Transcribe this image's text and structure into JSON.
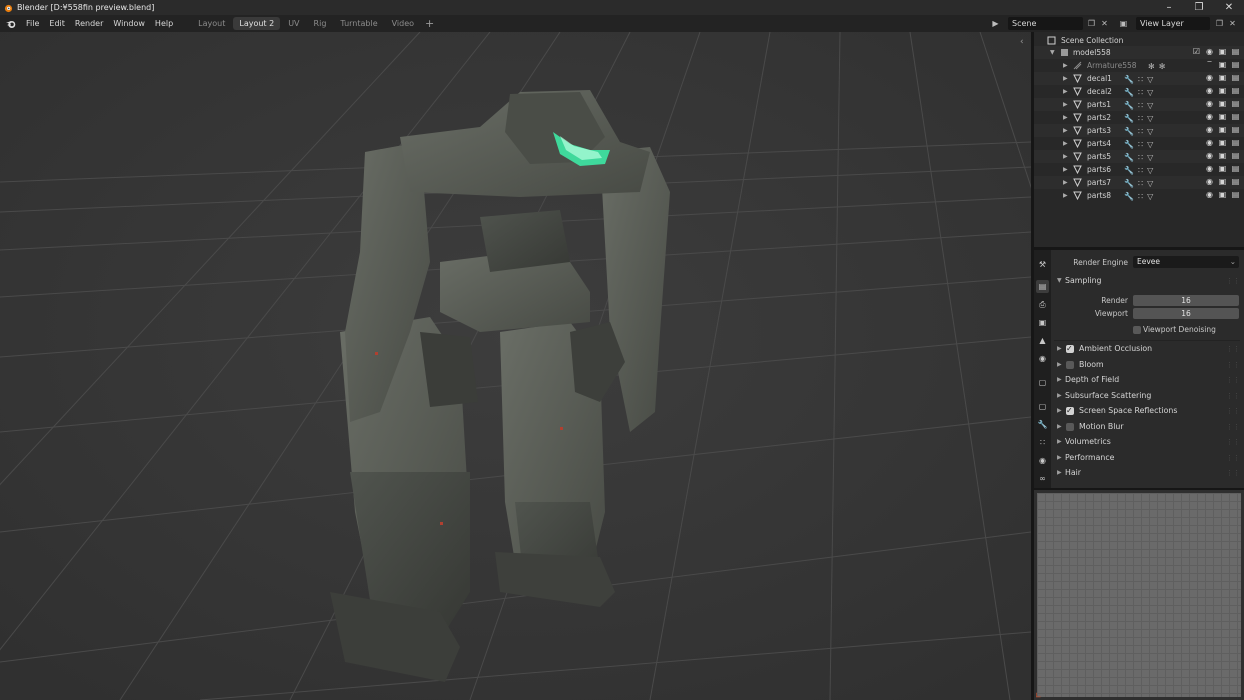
{
  "window": {
    "title": "Blender [D:¥558fin preview.blend]",
    "controls": [
      "minimize-icon",
      "maximize-icon",
      "close-icon"
    ]
  },
  "menu": {
    "items": [
      "File",
      "Edit",
      "Render",
      "Window",
      "Help"
    ]
  },
  "workspaces": {
    "tabs": [
      "Layout",
      "Layout 2",
      "UV",
      "Rig",
      "Turntable",
      "Video"
    ],
    "active": "Layout 2"
  },
  "header": {
    "scene": "Scene",
    "view_layer": "View Layer"
  },
  "outliner": {
    "root": "Scene Collection",
    "collection": "model558",
    "armature": "Armature558",
    "objects": [
      "decal1",
      "decal2",
      "parts1",
      "parts2",
      "parts3",
      "parts4",
      "parts5",
      "parts6",
      "parts7",
      "parts8"
    ]
  },
  "properties": {
    "render_engine_label": "Render Engine",
    "render_engine": "Eevee",
    "sampling": {
      "title": "Sampling",
      "render_label": "Render",
      "render_value": "16",
      "viewport_label": "Viewport",
      "viewport_value": "16",
      "denoise_label": "Viewport Denoising"
    },
    "panels": [
      {
        "label": "Ambient Occlusion",
        "checkbox": true,
        "checked": true
      },
      {
        "label": "Bloom",
        "checkbox": true,
        "checked": false
      },
      {
        "label": "Depth of Field",
        "checkbox": false
      },
      {
        "label": "Subsurface Scattering",
        "checkbox": false
      },
      {
        "label": "Screen Space Reflections",
        "checkbox": true,
        "checked": true
      },
      {
        "label": "Motion Blur",
        "checkbox": true,
        "checked": false
      },
      {
        "label": "Volumetrics",
        "checkbox": false
      },
      {
        "label": "Performance",
        "checkbox": false
      },
      {
        "label": "Hair",
        "checkbox": false
      }
    ]
  },
  "colors": {
    "viewport_bg": "#393939",
    "visor_glow": "#3ee0a0",
    "armor": "#5a5e56"
  }
}
